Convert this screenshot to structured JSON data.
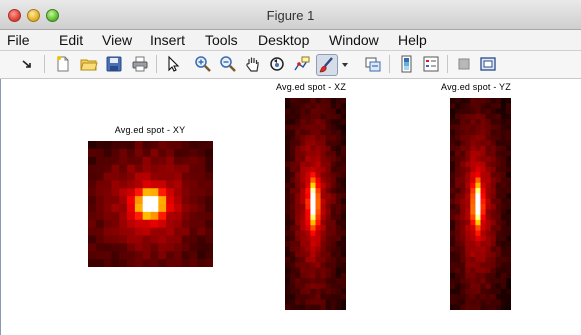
{
  "window": {
    "title": "Figure 1"
  },
  "menu": [
    "File",
    "Edit",
    "View",
    "Insert",
    "Tools",
    "Desktop",
    "Window",
    "Help"
  ],
  "toolbar_icons": [
    "dock-arrow-icon",
    "new-figure-icon",
    "open-file-icon",
    "save-icon",
    "print-icon",
    "pointer-icon",
    "zoom-in-icon",
    "zoom-out-icon",
    "pan-hand-icon",
    "rotate-3d-icon",
    "data-cursor-icon",
    "brush-icon",
    "brush-dropdown-icon",
    "link-plot-icon",
    "colorbar-icon",
    "legend-icon",
    "hide-plot-tools-icon",
    "show-plot-tools-icon"
  ],
  "plots": [
    {
      "key": "xy",
      "title": "Avg.ed spot - XY"
    },
    {
      "key": "xz",
      "title": "Avg.ed spot - XZ"
    },
    {
      "key": "yz",
      "title": "Avg.ed spot - YZ"
    }
  ],
  "chart_data": [
    {
      "type": "heatmap",
      "title": "Avg.ed spot - XY",
      "colormap": "hot",
      "grid": "off",
      "rows": 16,
      "cols": 16,
      "peak": {
        "row": 8,
        "col": 8
      },
      "spread": {
        "row": 1.1,
        "col": 1.1
      },
      "halo": {
        "row": 4.5,
        "col": 4.5,
        "weight": 0.22
      },
      "background": 0.08
    },
    {
      "type": "heatmap",
      "title": "Avg.ed spot - XZ",
      "colormap": "hot",
      "grid": "off",
      "rows": 40,
      "cols": 12,
      "peak": {
        "row": 20,
        "col": 5.6
      },
      "spread": {
        "row": 2.6,
        "col": 0.55
      },
      "halo": {
        "row": 11,
        "col": 2.6,
        "weight": 0.25
      },
      "background": 0.06
    },
    {
      "type": "heatmap",
      "title": "Avg.ed spot - YZ",
      "colormap": "hot",
      "grid": "off",
      "rows": 40,
      "cols": 12,
      "peak": {
        "row": 20,
        "col": 5.4
      },
      "spread": {
        "row": 2.6,
        "col": 0.55
      },
      "halo": {
        "row": 11,
        "col": 2.6,
        "weight": 0.25
      },
      "background": 0.06
    }
  ]
}
